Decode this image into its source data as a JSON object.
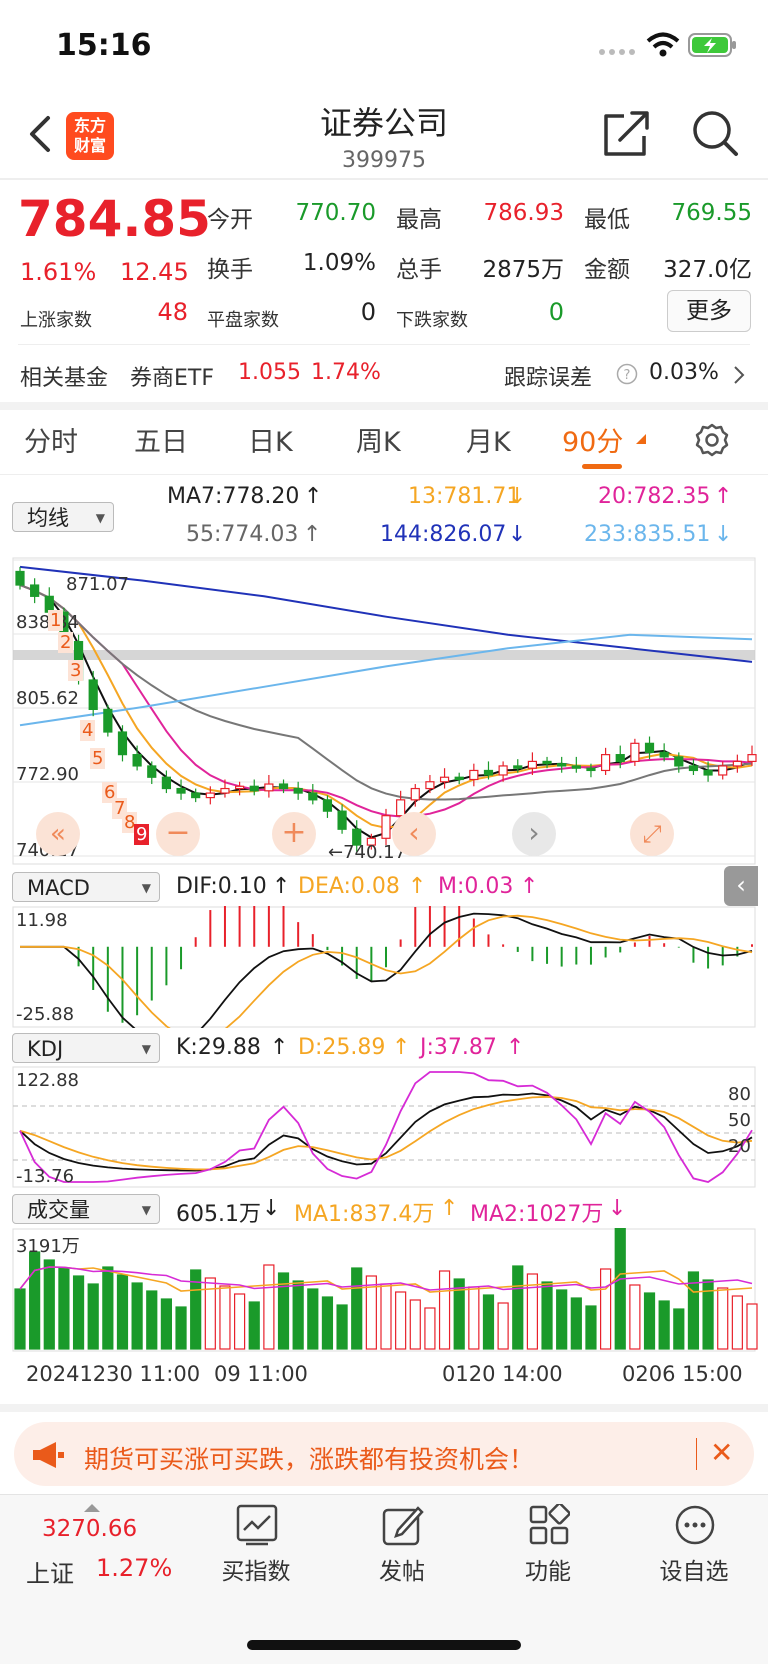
{
  "status": {
    "time": "15:16"
  },
  "header": {
    "title": "证券公司",
    "code": "399975",
    "logo_line1": "东方",
    "logo_line2": "财富"
  },
  "quote": {
    "price": "784.85",
    "change_pct": "1.61%",
    "change": "12.45",
    "open_label": "今开",
    "open": "770.70",
    "high_label": "最高",
    "high": "786.93",
    "low_label": "最低",
    "low": "769.55",
    "turnover_label": "换手",
    "turnover": "1.09%",
    "volume_label": "总手",
    "volume": "2875万",
    "amount_label": "金额",
    "amount": "327.0亿",
    "up_label": "上涨家数",
    "up": "48",
    "flat_label": "平盘家数",
    "flat": "0",
    "down_label": "下跌家数",
    "down": "0",
    "more": "更多"
  },
  "fund": {
    "label": "相关基金",
    "name": "券商ETF",
    "price": "1.055",
    "pct": "1.74%",
    "error_label": "跟踪误差",
    "error": "0.03%"
  },
  "tabs": [
    "分时",
    "五日",
    "日K",
    "周K",
    "月K",
    "90分"
  ],
  "chart": {
    "ma_select": "均线",
    "ma7": "MA7:778.20",
    "ma13": "13:781.71",
    "ma20": "20:782.35",
    "ma55": "55:774.03",
    "ma144": "144:826.07",
    "ma233": "233:835.51",
    "y_top": "871.07",
    "y1": "838.34",
    "y2": "805.62",
    "y3": "772.90",
    "y_bottom": "740.17",
    "high_label": "871.07",
    "low_label": "←740.17",
    "macd_select": "MACD",
    "dif": "DIF:0.10",
    "dea": "DEA:0.08",
    "m": "M:0.03",
    "macd_top": "11.98",
    "macd_bottom": "-25.88",
    "kdj_select": "KDJ",
    "k": "K:29.88",
    "d": "D:25.89",
    "j": "J:37.87",
    "kdj_top": "122.88",
    "kdj_bottom": "-13.76",
    "kdj_80": "80",
    "kdj_50": "50",
    "kdj_20": "20",
    "vol_select": "成交量",
    "vol": "605.1万",
    "vol_ma1": "MA1:837.4万",
    "vol_ma2": "MA2:1027万",
    "vol_top": "3191万",
    "dates": [
      "20241230 11:00",
      "09 11:00",
      "0120 14:00",
      "0206 15:00"
    ]
  },
  "chart_data": {
    "type": "candlestick",
    "ylim": [
      740.17,
      871.07
    ],
    "y_ticks": [
      871.07,
      838.34,
      805.62,
      772.9,
      740.17
    ],
    "ma": {
      "MA7": 778.2,
      "MA13": 781.71,
      "MA20": 782.35,
      "MA55": 774.03,
      "MA144": 826.07,
      "MA233": 835.51
    },
    "high": 871.07,
    "low": 740.17,
    "close_series": [
      860,
      855,
      848,
      835,
      818,
      805,
      795,
      785,
      780,
      775,
      770,
      768,
      766,
      768,
      770,
      771,
      769,
      772,
      770,
      768,
      765,
      760,
      752,
      745,
      748,
      758,
      765,
      770,
      773,
      775,
      774,
      778,
      776,
      780,
      779,
      782,
      781,
      780,
      779,
      778,
      785,
      782,
      790,
      786,
      784,
      780,
      778,
      776,
      780,
      782,
      785
    ]
  },
  "banner": {
    "text": "期货可买涨可买跌，涨跌都有投资机会！"
  },
  "bottom": {
    "index_value": "3270.66",
    "index_name": "上证",
    "index_pct": "1.27%",
    "nav": [
      "买指数",
      "发帖",
      "功能",
      "设自选"
    ]
  }
}
